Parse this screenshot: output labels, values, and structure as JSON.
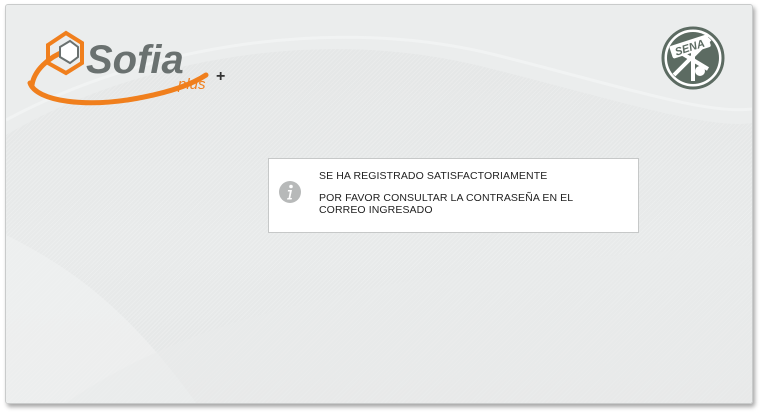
{
  "header": {
    "app_logo_text": "Sofia",
    "app_logo_subtext": "plus",
    "institution_logo_text": "SENA"
  },
  "message": {
    "icon": "info-icon",
    "line1": "SE HA REGISTRADO SATISFACTORIAMENTE",
    "line2": "POR FAVOR CONSULTAR LA CONTRASEÑA EN EL",
    "line3": "CORREO INGRESADO"
  },
  "colors": {
    "brand_orange": "#f07f1d",
    "brand_gray": "#6a7170",
    "sena_green": "#5c6b62",
    "background": "#e6e8e8",
    "icon_gray": "#b7b9b9"
  }
}
